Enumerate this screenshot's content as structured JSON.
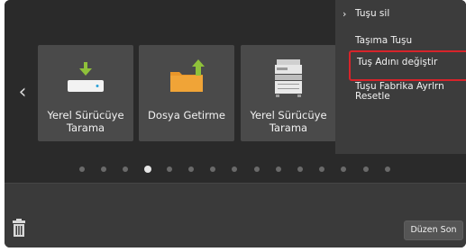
{
  "tiles": [
    {
      "label": "Yerel Sürücüye Tarama",
      "icon": "scan-to-drive-icon"
    },
    {
      "label": "Dosya Getirme",
      "icon": "folder-upload-icon"
    },
    {
      "label": "Yerel Sürücüye Tarama",
      "icon": "printer-icon"
    }
  ],
  "context_menu": {
    "items": [
      {
        "label": "Tuşu sil"
      },
      {
        "label": "Taşıma Tuşu"
      },
      {
        "label": "Tuş Adını değiştir"
      },
      {
        "label": "Tuşu Fabrika Ayrlrn Resetle"
      }
    ]
  },
  "pagination": {
    "count": 15,
    "active_index": 3
  },
  "footer": {
    "done_label": "Düzen Son"
  },
  "colors": {
    "background": "#2a2a2a",
    "tile": "#4a4a4a",
    "green_arrow": "#8fc13a",
    "folder_orange": "#e8962a",
    "selection_yellow": "#e8cf3a",
    "highlight_red": "#d8232a"
  }
}
